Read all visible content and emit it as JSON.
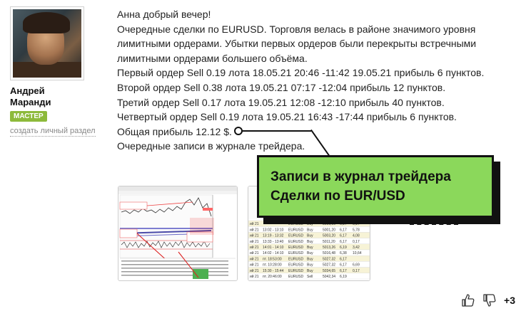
{
  "author": {
    "name_line1": "Андрей",
    "name_line2": "Маранди",
    "badge": "МАСТЕР",
    "profile_link": "создать личный раздел"
  },
  "post": {
    "lines": [
      "Анна добрый вечер!",
      "Очередные сделки по EURUSD. Торговля велась в районе значимого уровня",
      "лимитными ордерами. Убытки первых ордеров были перекрыты встречными",
      "лимитными ордерами большего объёма.",
      "Первый ордер Sell 0.19 лота 18.05.21 20:46 -11:42 19.05.21 прибыль 6 пунктов.",
      "Второй ордер Sell 0.38 лота 19.05.21 07:17 -12:04 прибыль 12 пунктов.",
      "Третий ордер Sell 0.17 лота 19.05.21 12:08 -12:10 прибыль 40 пунктов.",
      "Четвертый ордер Sell 0.19 лота 19.05.21 16:43 -17:44 прибыль 6 пунктов.",
      "Общая прибыль 12.12 $.",
      "Очередные записи в журнале трейдера."
    ]
  },
  "callout": {
    "line1": "Записи в журнал трейдера",
    "line2": "Сделки по EUR/USD"
  },
  "journal_table": {
    "rows": [
      [
        "ий 21",
        "",
        "EURUSD",
        "Buy",
        "5000,06",
        "6,17",
        "0,17"
      ],
      [
        "ий 21",
        "13:02 - 13:10",
        "EURUSD",
        "Buy",
        "5001,20",
        "6,17",
        "5,78"
      ],
      [
        "ий 21",
        "13:19 - 13:32",
        "EURUSD",
        "Buy",
        "5003,20",
        "6,17",
        "4,08"
      ],
      [
        "ий 21",
        "13:33 - 13:40",
        "EURUSD",
        "Buy",
        "5011,20",
        "6,17",
        "0,17"
      ],
      [
        "ий 21",
        "14:01 - 14:10",
        "EURUSD",
        "Buy",
        "5013,26",
        "6,19",
        "3,42"
      ],
      [
        "ий 21",
        "14:02 - 14:10",
        "EURUSD",
        "Buy",
        "5016,48",
        "6,38",
        "10,64"
      ],
      [
        "ий 21",
        "пт. 18:53:00",
        "EURUSD",
        "Buy",
        "5027,32",
        "6,17",
        ""
      ],
      [
        "ий 21",
        "пт. 10:28:00",
        "EURUSD",
        "Buy",
        "5027,32",
        "6,17",
        "6,69"
      ],
      [
        "ий 21",
        "15:30 - 15:44",
        "EURUSD",
        "Buy",
        "5034,65",
        "6,17",
        "0,17"
      ],
      [
        "ий 21",
        "пт. 20:46:00",
        "EURUSD",
        "Sell",
        "5042,34",
        "6,19",
        ""
      ]
    ]
  },
  "reactions": {
    "count": "+3"
  }
}
